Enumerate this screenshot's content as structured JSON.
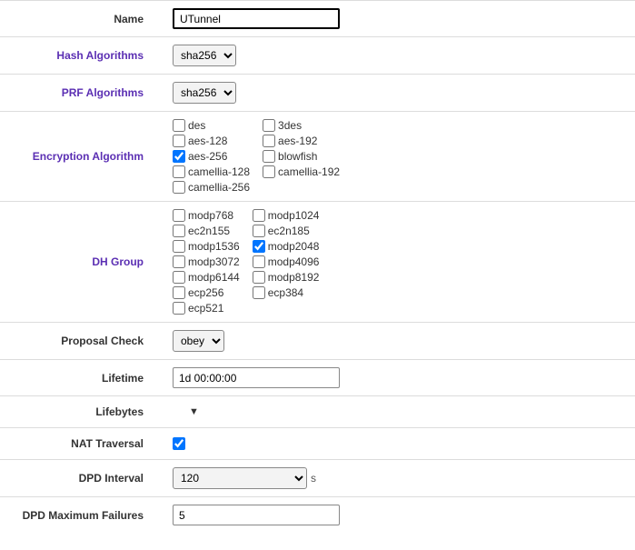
{
  "name": {
    "label": "Name",
    "value": "UTunnel"
  },
  "hash_algorithms": {
    "label": "Hash Algorithms",
    "value": "sha256"
  },
  "prf_algorithms": {
    "label": "PRF Algorithms",
    "value": "sha256"
  },
  "encryption_algorithm": {
    "label": "Encryption Algorithm",
    "col1": [
      {
        "label": "des",
        "checked": false
      },
      {
        "label": "aes-128",
        "checked": false
      },
      {
        "label": "aes-256",
        "checked": true
      },
      {
        "label": "camellia-128",
        "checked": false
      },
      {
        "label": "camellia-256",
        "checked": false
      }
    ],
    "col2": [
      {
        "label": "3des",
        "checked": false
      },
      {
        "label": "aes-192",
        "checked": false
      },
      {
        "label": "blowfish",
        "checked": false
      },
      {
        "label": "camellia-192",
        "checked": false
      }
    ]
  },
  "dh_group": {
    "label": "DH Group",
    "col1": [
      {
        "label": "modp768",
        "checked": false
      },
      {
        "label": "ec2n155",
        "checked": false
      },
      {
        "label": "modp1536",
        "checked": false
      },
      {
        "label": "modp3072",
        "checked": false
      },
      {
        "label": "modp6144",
        "checked": false
      },
      {
        "label": "ecp256",
        "checked": false
      },
      {
        "label": "ecp521",
        "checked": false
      }
    ],
    "col2": [
      {
        "label": "modp1024",
        "checked": false
      },
      {
        "label": "ec2n185",
        "checked": false
      },
      {
        "label": "modp2048",
        "checked": true
      },
      {
        "label": "modp4096",
        "checked": false
      },
      {
        "label": "modp8192",
        "checked": false
      },
      {
        "label": "ecp384",
        "checked": false
      }
    ]
  },
  "proposal_check": {
    "label": "Proposal Check",
    "value": "obey"
  },
  "lifetime": {
    "label": "Lifetime",
    "value": "1d 00:00:00"
  },
  "lifebytes": {
    "label": "Lifebytes"
  },
  "nat_traversal": {
    "label": "NAT Traversal",
    "checked": true
  },
  "dpd_interval": {
    "label": "DPD Interval",
    "value": "120",
    "unit": "s"
  },
  "dpd_maximum_failures": {
    "label": "DPD Maximum Failures",
    "value": "5"
  }
}
